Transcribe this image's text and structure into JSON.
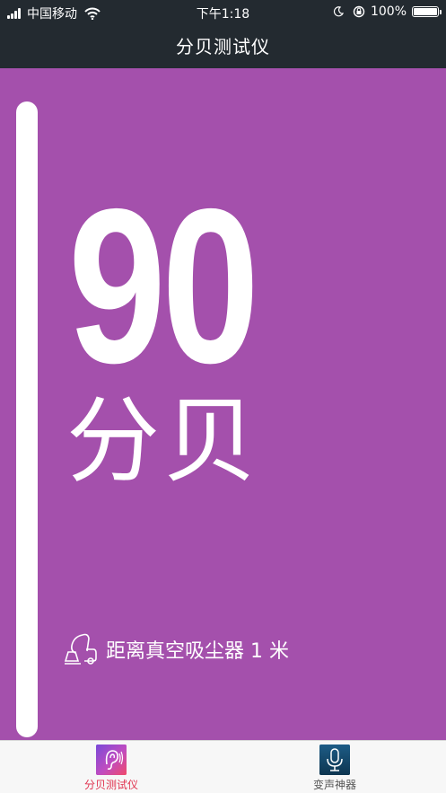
{
  "status_bar": {
    "carrier": "中国移动",
    "time": "下午1:18",
    "battery": "100%",
    "battery_level": 1.0
  },
  "nav": {
    "title": "分贝测试仪"
  },
  "meter": {
    "value": "90",
    "unit": "分贝",
    "reference_text": "距离真空吸尘器 1 米",
    "reference_icon": "vacuum-cleaner-icon"
  },
  "tabs": [
    {
      "label": "分贝测试仪",
      "icon": "ear-icon",
      "active": true,
      "color": "#e0334f"
    },
    {
      "label": "变声神器",
      "icon": "microphone-icon",
      "active": false,
      "color": "#555555"
    }
  ],
  "colors": {
    "background": "#a450ac",
    "header": "#232a30",
    "accent": "#e0334f"
  }
}
